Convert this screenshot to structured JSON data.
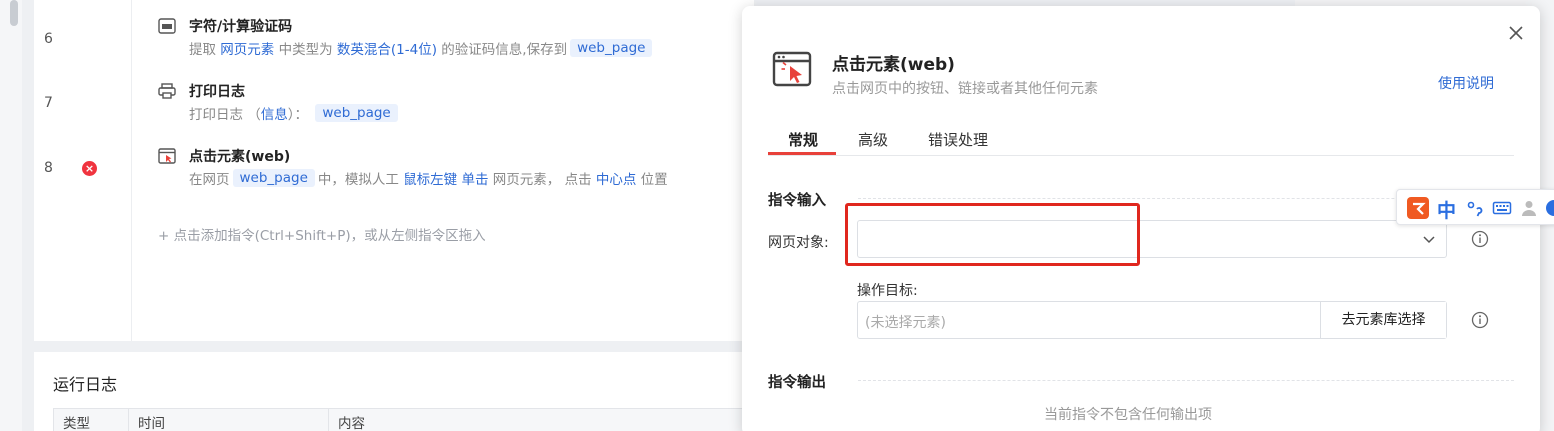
{
  "flow": {
    "steps": [
      {
        "num": "6",
        "title": "字符/计算验证码",
        "desc": {
          "p1": "提取",
          "l1": "网页元素",
          "p2": "中类型为",
          "l2": "数英混合(1-4位)",
          "p3": "的验证码信息,保存到",
          "t1": "web_page"
        }
      },
      {
        "num": "7",
        "title": "打印日志",
        "desc": {
          "p1": "打印日志 （",
          "l1": "信息",
          "p2": "）：",
          "t1": "web_page"
        }
      },
      {
        "num": "8",
        "error": "×",
        "title": "点击元素(web)",
        "desc": {
          "p1": "在网页",
          "t1": "web_page",
          "p2": "中，模拟人工",
          "l1": "鼠标左键",
          "l2": "单击",
          "p3": "网页元素， 点击",
          "l3": "中心点",
          "p4": "位置"
        }
      }
    ],
    "add_hint": "+  点击添加指令(Ctrl+Shift+P)，或从左侧指令区拖入"
  },
  "log": {
    "title": "运行日志",
    "columns": [
      "类型",
      "时间",
      "内容"
    ]
  },
  "dialog": {
    "title": "点击元素(web)",
    "subtitle": "点击网页中的按钮、链接或者其他任何元素",
    "help": "使用说明",
    "tabs": [
      "常规",
      "高级",
      "错误处理"
    ],
    "input_section": "指令输入",
    "page_object_label": "网页对象:",
    "page_object_value": "",
    "target_label": "操作目标:",
    "target_placeholder": "(未选择元素)",
    "library_button": "去元素库选择",
    "output_section": "指令输出",
    "no_output": "当前指令不包含任何输出项"
  },
  "ime": {
    "mode": "中"
  },
  "colors": {
    "accent_red": "#e8413a",
    "link_blue": "#2f6bd4",
    "error_red": "#f0343f",
    "highlight_red": "#e0271e"
  }
}
